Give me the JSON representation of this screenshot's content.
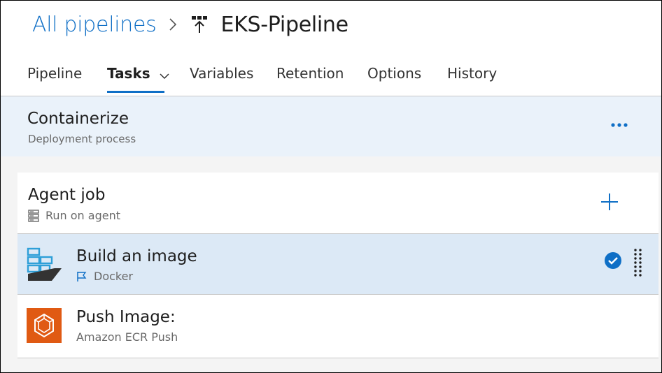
{
  "breadcrumb": {
    "parent": "All pipelines",
    "current": "EKS-Pipeline",
    "pipeline_icon": "pipeline-release-icon",
    "separator_icon": "chevron-right-icon"
  },
  "tabs": [
    {
      "label": "Pipeline",
      "active": false
    },
    {
      "label": "Tasks",
      "active": true,
      "has_dropdown": true
    },
    {
      "label": "Variables",
      "active": false
    },
    {
      "label": "Retention",
      "active": false
    },
    {
      "label": "Options",
      "active": false
    },
    {
      "label": "History",
      "active": false
    }
  ],
  "process": {
    "title": "Containerize",
    "subtitle": "Deployment process",
    "more_icon": "more-actions-icon"
  },
  "agent_job": {
    "title": "Agent job",
    "subtitle": "Run on agent",
    "subtitle_icon": "server-icon",
    "add_icon": "plus-icon"
  },
  "tasks": [
    {
      "title": "Build an image",
      "subtitle": "Docker",
      "icon": "docker-icon",
      "subtitle_icon": "flag-icon",
      "selected": true
    },
    {
      "title": "Push Image:",
      "subtitle": "Amazon ECR Push",
      "icon": "amazon-ecr-icon",
      "selected": false
    }
  ],
  "colors": {
    "accent": "#0f6fc6",
    "selected_bg": "#dce9f6",
    "process_bg": "#eaf2fa",
    "aws_orange": "#e05a13"
  }
}
